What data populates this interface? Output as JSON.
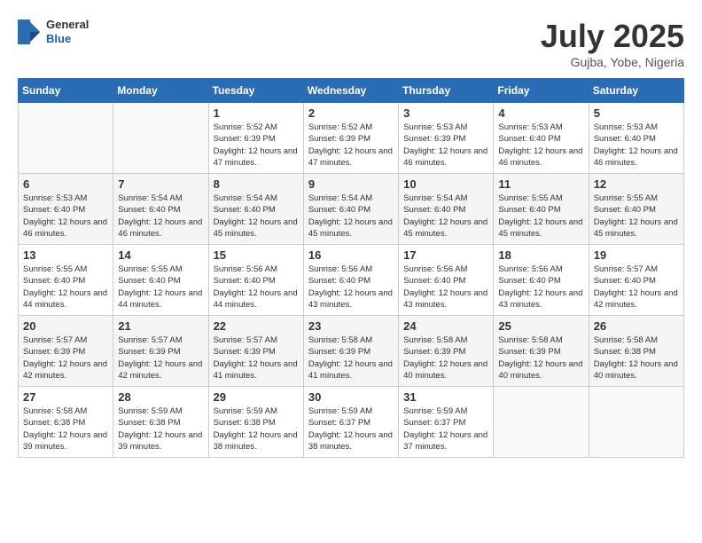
{
  "header": {
    "logo_general": "General",
    "logo_blue": "Blue",
    "month": "July 2025",
    "location": "Gujba, Yobe, Nigeria"
  },
  "days_of_week": [
    "Sunday",
    "Monday",
    "Tuesday",
    "Wednesday",
    "Thursday",
    "Friday",
    "Saturday"
  ],
  "weeks": [
    [
      {
        "day": "",
        "info": ""
      },
      {
        "day": "",
        "info": ""
      },
      {
        "day": "1",
        "info": "Sunrise: 5:52 AM\nSunset: 6:39 PM\nDaylight: 12 hours and 47 minutes."
      },
      {
        "day": "2",
        "info": "Sunrise: 5:52 AM\nSunset: 6:39 PM\nDaylight: 12 hours and 47 minutes."
      },
      {
        "day": "3",
        "info": "Sunrise: 5:53 AM\nSunset: 6:39 PM\nDaylight: 12 hours and 46 minutes."
      },
      {
        "day": "4",
        "info": "Sunrise: 5:53 AM\nSunset: 6:40 PM\nDaylight: 12 hours and 46 minutes."
      },
      {
        "day": "5",
        "info": "Sunrise: 5:53 AM\nSunset: 6:40 PM\nDaylight: 12 hours and 46 minutes."
      }
    ],
    [
      {
        "day": "6",
        "info": "Sunrise: 5:53 AM\nSunset: 6:40 PM\nDaylight: 12 hours and 46 minutes."
      },
      {
        "day": "7",
        "info": "Sunrise: 5:54 AM\nSunset: 6:40 PM\nDaylight: 12 hours and 46 minutes."
      },
      {
        "day": "8",
        "info": "Sunrise: 5:54 AM\nSunset: 6:40 PM\nDaylight: 12 hours and 45 minutes."
      },
      {
        "day": "9",
        "info": "Sunrise: 5:54 AM\nSunset: 6:40 PM\nDaylight: 12 hours and 45 minutes."
      },
      {
        "day": "10",
        "info": "Sunrise: 5:54 AM\nSunset: 6:40 PM\nDaylight: 12 hours and 45 minutes."
      },
      {
        "day": "11",
        "info": "Sunrise: 5:55 AM\nSunset: 6:40 PM\nDaylight: 12 hours and 45 minutes."
      },
      {
        "day": "12",
        "info": "Sunrise: 5:55 AM\nSunset: 6:40 PM\nDaylight: 12 hours and 45 minutes."
      }
    ],
    [
      {
        "day": "13",
        "info": "Sunrise: 5:55 AM\nSunset: 6:40 PM\nDaylight: 12 hours and 44 minutes."
      },
      {
        "day": "14",
        "info": "Sunrise: 5:55 AM\nSunset: 6:40 PM\nDaylight: 12 hours and 44 minutes."
      },
      {
        "day": "15",
        "info": "Sunrise: 5:56 AM\nSunset: 6:40 PM\nDaylight: 12 hours and 44 minutes."
      },
      {
        "day": "16",
        "info": "Sunrise: 5:56 AM\nSunset: 6:40 PM\nDaylight: 12 hours and 43 minutes."
      },
      {
        "day": "17",
        "info": "Sunrise: 5:56 AM\nSunset: 6:40 PM\nDaylight: 12 hours and 43 minutes."
      },
      {
        "day": "18",
        "info": "Sunrise: 5:56 AM\nSunset: 6:40 PM\nDaylight: 12 hours and 43 minutes."
      },
      {
        "day": "19",
        "info": "Sunrise: 5:57 AM\nSunset: 6:40 PM\nDaylight: 12 hours and 42 minutes."
      }
    ],
    [
      {
        "day": "20",
        "info": "Sunrise: 5:57 AM\nSunset: 6:39 PM\nDaylight: 12 hours and 42 minutes."
      },
      {
        "day": "21",
        "info": "Sunrise: 5:57 AM\nSunset: 6:39 PM\nDaylight: 12 hours and 42 minutes."
      },
      {
        "day": "22",
        "info": "Sunrise: 5:57 AM\nSunset: 6:39 PM\nDaylight: 12 hours and 41 minutes."
      },
      {
        "day": "23",
        "info": "Sunrise: 5:58 AM\nSunset: 6:39 PM\nDaylight: 12 hours and 41 minutes."
      },
      {
        "day": "24",
        "info": "Sunrise: 5:58 AM\nSunset: 6:39 PM\nDaylight: 12 hours and 40 minutes."
      },
      {
        "day": "25",
        "info": "Sunrise: 5:58 AM\nSunset: 6:39 PM\nDaylight: 12 hours and 40 minutes."
      },
      {
        "day": "26",
        "info": "Sunrise: 5:58 AM\nSunset: 6:38 PM\nDaylight: 12 hours and 40 minutes."
      }
    ],
    [
      {
        "day": "27",
        "info": "Sunrise: 5:58 AM\nSunset: 6:38 PM\nDaylight: 12 hours and 39 minutes."
      },
      {
        "day": "28",
        "info": "Sunrise: 5:59 AM\nSunset: 6:38 PM\nDaylight: 12 hours and 39 minutes."
      },
      {
        "day": "29",
        "info": "Sunrise: 5:59 AM\nSunset: 6:38 PM\nDaylight: 12 hours and 38 minutes."
      },
      {
        "day": "30",
        "info": "Sunrise: 5:59 AM\nSunset: 6:37 PM\nDaylight: 12 hours and 38 minutes."
      },
      {
        "day": "31",
        "info": "Sunrise: 5:59 AM\nSunset: 6:37 PM\nDaylight: 12 hours and 37 minutes."
      },
      {
        "day": "",
        "info": ""
      },
      {
        "day": "",
        "info": ""
      }
    ]
  ]
}
